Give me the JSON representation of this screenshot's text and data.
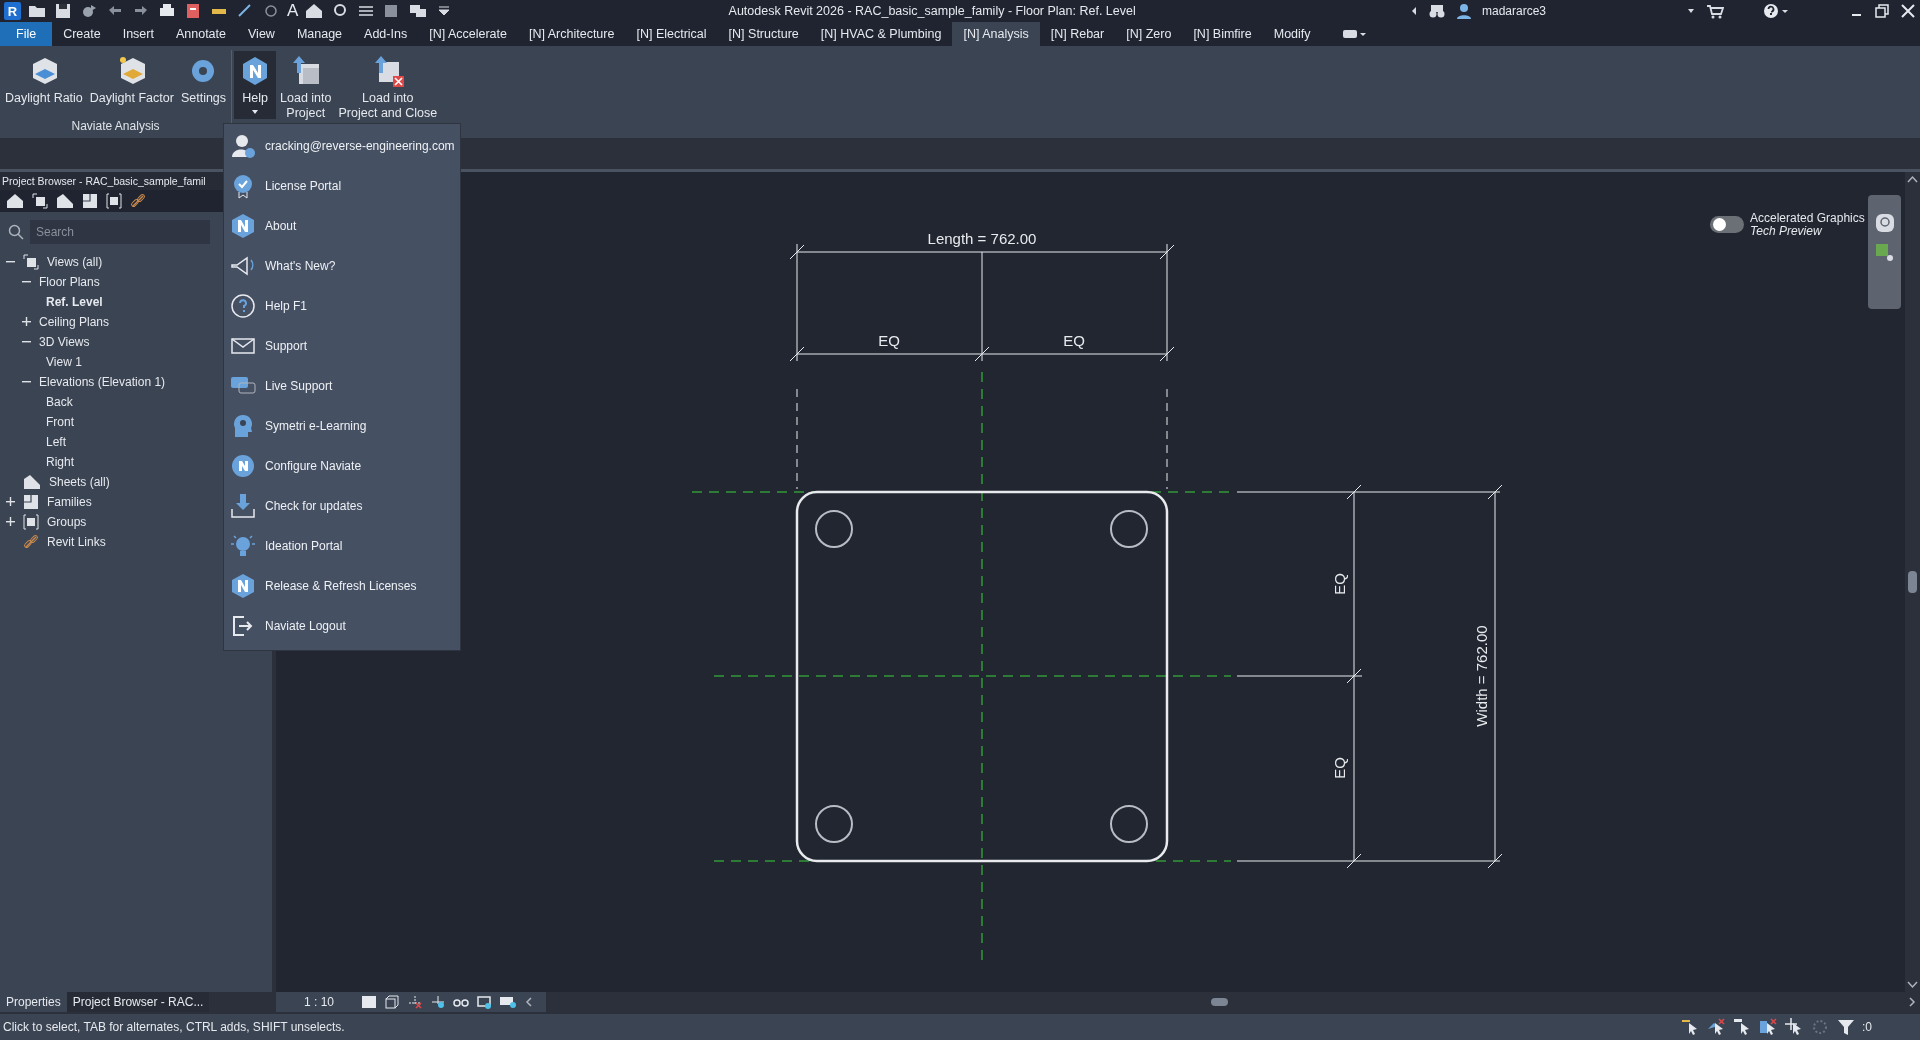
{
  "title_bar": {
    "app_logo": "R",
    "text_tool": "A",
    "title": "Autodesk Revit 2026 - RAC_basic_sample_family - Floor Plan: Ref. Level",
    "user": "madararce3"
  },
  "ribbon_tabs": [
    {
      "label": "File",
      "kind": "application"
    },
    {
      "label": "Create",
      "kind": "tab",
      "selected": false
    },
    {
      "label": "Insert",
      "kind": "tab",
      "selected": false
    },
    {
      "label": "Annotate",
      "kind": "tab",
      "selected": false
    },
    {
      "label": "View",
      "kind": "tab",
      "selected": false
    },
    {
      "label": "Manage",
      "kind": "tab",
      "selected": false
    },
    {
      "label": "Add-Ins",
      "kind": "tab",
      "selected": false
    },
    {
      "label": "[N] Accelerate",
      "kind": "tab",
      "selected": false
    },
    {
      "label": "[N] Architecture",
      "kind": "tab",
      "selected": false
    },
    {
      "label": "[N] Electrical",
      "kind": "tab",
      "selected": false
    },
    {
      "label": "[N] Structure",
      "kind": "tab",
      "selected": false
    },
    {
      "label": "[N] HVAC & Plumbing",
      "kind": "tab",
      "selected": false
    },
    {
      "label": "[N] Analysis",
      "kind": "tab",
      "selected": true
    },
    {
      "label": "[N] Rebar",
      "kind": "tab",
      "selected": false
    },
    {
      "label": "[N] Zero",
      "kind": "tab",
      "selected": false
    },
    {
      "label": "[N] Bimfire",
      "kind": "tab",
      "selected": false
    },
    {
      "label": "Modify",
      "kind": "tab",
      "selected": false
    }
  ],
  "ribbon_panels": [
    {
      "label": "Naviate Analysis",
      "buttons": [
        {
          "label": "Daylight Ratio",
          "pressed": false
        },
        {
          "label": "Daylight Factor",
          "pressed": false
        },
        {
          "label": "Settings",
          "pressed": false
        }
      ]
    },
    {
      "buttons": [
        {
          "label": "Help",
          "pressed": true
        },
        {
          "label": "Load into\nProject",
          "pressed": false
        },
        {
          "label": "Load into\nProject and Close",
          "pressed": false
        }
      ]
    }
  ],
  "help_menu": {
    "items": [
      {
        "label": "cracking@reverse-engineering.com"
      },
      {
        "label": "License Portal"
      },
      {
        "label": "About"
      },
      {
        "label": "What's New?"
      },
      {
        "label": "Help F1"
      },
      {
        "label": "Support"
      },
      {
        "label": "Live Support"
      },
      {
        "label": "Symetri e-Learning"
      },
      {
        "label": "Configure Naviate"
      },
      {
        "label": "Check for updates"
      },
      {
        "label": "Ideation Portal"
      },
      {
        "label": "Release & Refresh Licenses"
      },
      {
        "label": "Naviate Logout"
      }
    ]
  },
  "project_browser": {
    "title": "Project Browser - RAC_basic_sample_famil",
    "search": {
      "placeholder": "Search"
    },
    "tree": [
      {
        "label": "Views (all)",
        "kind": "views",
        "expanded": true,
        "selected": false,
        "children": [
          {
            "label": "Floor Plans",
            "expanded": true,
            "selected": false,
            "children": [
              {
                "label": "Ref. Level",
                "selected": true
              }
            ]
          },
          {
            "label": "Ceiling Plans",
            "expanded": false,
            "selected": false
          },
          {
            "label": "3D Views",
            "expanded": true,
            "selected": false,
            "children": [
              {
                "label": "View 1",
                "selected": false
              }
            ]
          },
          {
            "label": "Elevations (Elevation 1)",
            "expanded": true,
            "selected": false,
            "children": [
              {
                "label": "Back",
                "selected": false
              },
              {
                "label": "Front",
                "selected": false
              },
              {
                "label": "Left",
                "selected": false
              },
              {
                "label": "Right",
                "selected": false
              }
            ]
          }
        ]
      },
      {
        "label": "Sheets (all)",
        "kind": "sheets",
        "selected": false
      },
      {
        "label": "Families",
        "kind": "families",
        "expanded": false,
        "selected": false
      },
      {
        "label": "Groups",
        "kind": "groups",
        "expanded": false,
        "selected": false
      },
      {
        "label": "Revit Links",
        "kind": "links",
        "selected": false
      }
    ]
  },
  "canvas": {
    "length_label": "Length = 762.00",
    "width_label": "Width = 762.00",
    "eq_labels": [
      "EQ",
      "EQ",
      "EQ",
      "EQ"
    ],
    "toggle": {
      "label": "Accelerated Graphics",
      "sublabel": "Tech Preview",
      "on": false
    }
  },
  "bottom_tabs": [
    {
      "label": "Properties",
      "selected": false
    },
    {
      "label": "Project Browser - RAC...",
      "selected": true
    }
  ],
  "view_control": {
    "scale": "1 : 10"
  },
  "status_bar": {
    "text": "Click to select, TAB for alternates, CTRL adds, SHIFT unselects.",
    "filter_count": ":0"
  }
}
